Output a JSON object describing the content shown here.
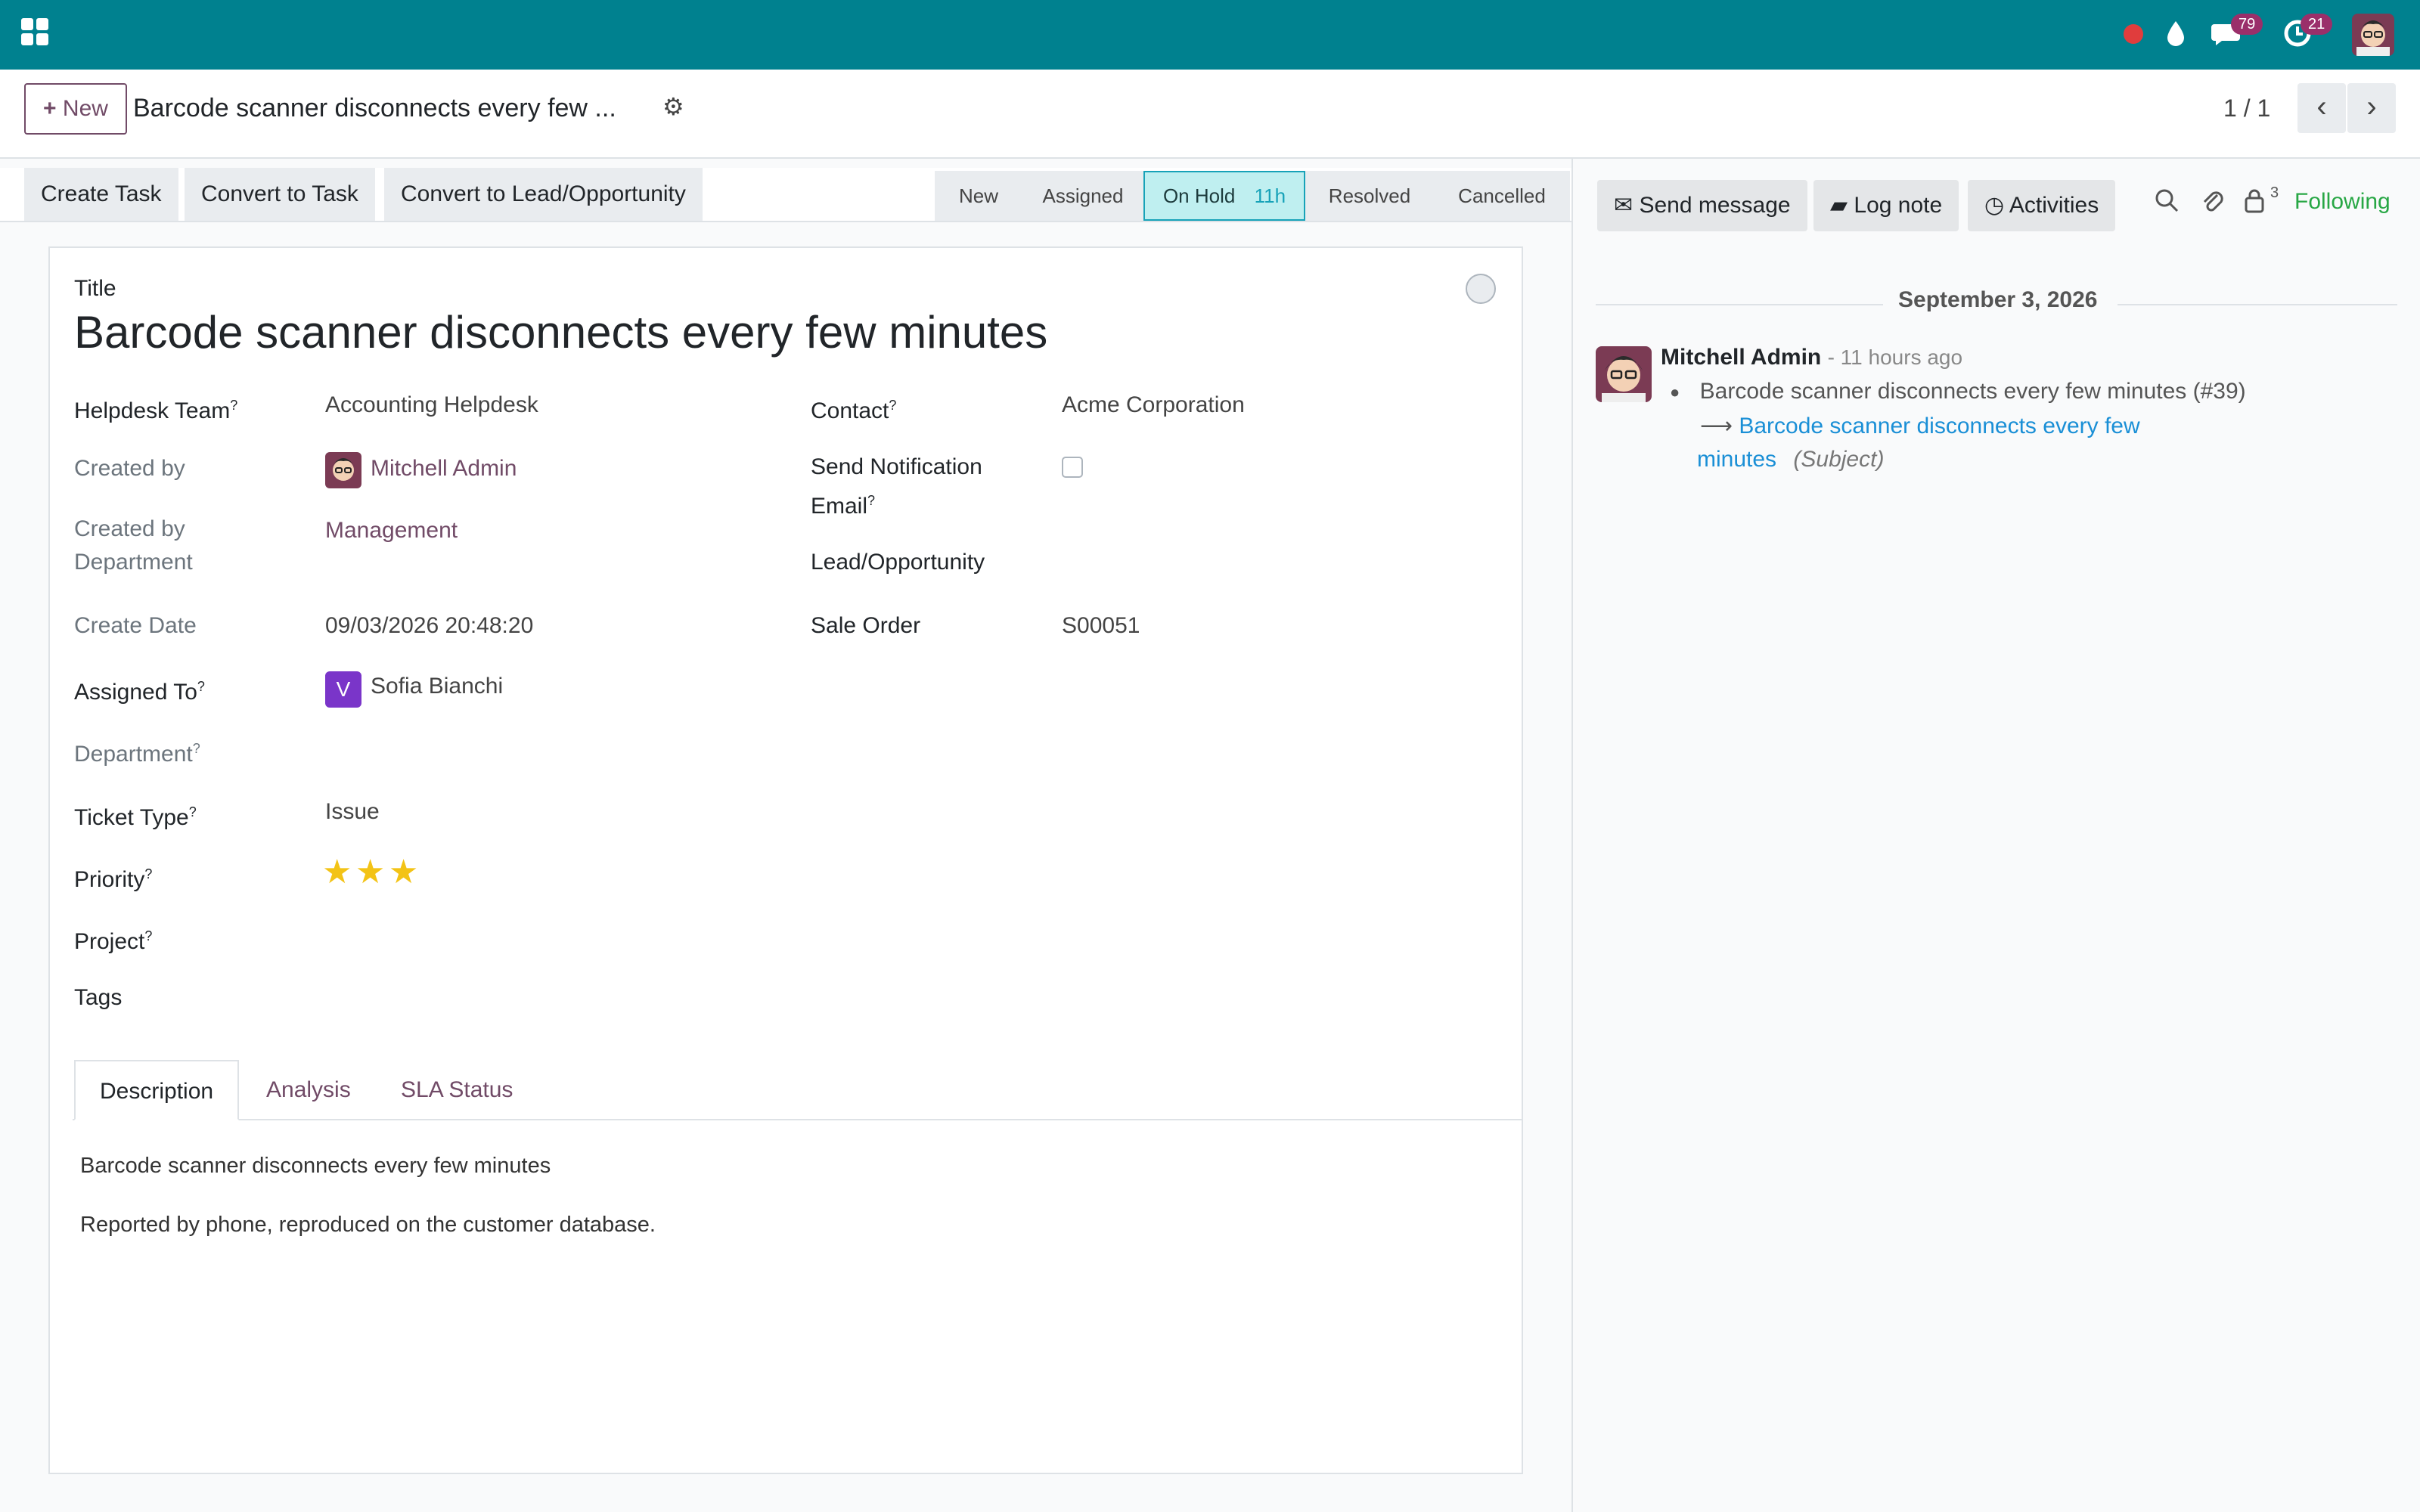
{
  "navbar": {
    "messages_count": "79",
    "activities_count": "21"
  },
  "control": {
    "new_label": "New",
    "breadcrumb": "Barcode scanner disconnects every few ...",
    "pager": "1 / 1"
  },
  "actions": [
    "Create Task",
    "Convert to Task",
    "Convert to Lead/Opportunity"
  ],
  "stages": [
    {
      "label": "New"
    },
    {
      "label": "Assigned"
    },
    {
      "label": "On Hold",
      "badge": "11h"
    },
    {
      "label": "Resolved"
    },
    {
      "label": "Cancelled"
    }
  ],
  "form": {
    "title_label": "Title",
    "title": "Barcode scanner disconnects every few minutes",
    "left_fields": {
      "helpdesk_team": {
        "label": "Helpdesk Team",
        "value": "Accounting Helpdesk"
      },
      "created_by": {
        "label": "Created by",
        "value": "Mitchell Admin"
      },
      "created_by_department_1": {
        "label": "Created by",
        "value": "Management"
      },
      "created_by_department_2": {
        "label": "Department"
      },
      "create_date": {
        "label": "Create Date",
        "value": "09/03/2026 20:48:20"
      },
      "assigned_to": {
        "label": "Assigned To",
        "value": "Sofia Bianchi",
        "initial": "V"
      },
      "department": {
        "label": "Department"
      },
      "ticket_type": {
        "label": "Ticket Type",
        "value": "Issue"
      },
      "priority": {
        "label": "Priority",
        "stars": 3
      },
      "project": {
        "label": "Project"
      },
      "tags": {
        "label": "Tags"
      }
    },
    "right_fields": {
      "contact": {
        "label": "Contact",
        "value": "Acme Corporation"
      },
      "send_notification_1": {
        "label": "Send Notification"
      },
      "send_notification_2": {
        "label": "Email"
      },
      "lead": {
        "label": "Lead/Opportunity"
      },
      "sale_order": {
        "label": "Sale Order",
        "value": "S00051"
      }
    },
    "tooltip_mark": "?",
    "tabs": [
      "Description",
      "Analysis",
      "SLA Status"
    ],
    "description": [
      "Barcode scanner disconnects every few minutes",
      "Reported by phone, reproduced on the customer database."
    ]
  },
  "chatter": {
    "send_message": "Send message",
    "log_note": "Log note",
    "activities": "Activities",
    "followers_count": "3",
    "following": "Following",
    "date": "September 3, 2026",
    "message": {
      "author": "Mitchell Admin",
      "time": "- 11 hours ago",
      "old_value": "Barcode scanner disconnects every few minutes (#39)",
      "new_value_1": "Barcode scanner disconnects every few",
      "new_value_2": "minutes",
      "field": "(Subject)"
    }
  },
  "colors": {
    "navbar": "#00818f",
    "brand": "#714b67",
    "active_stage": "#bfeff0",
    "following": "#28a745",
    "link": "#1a8fd6"
  }
}
